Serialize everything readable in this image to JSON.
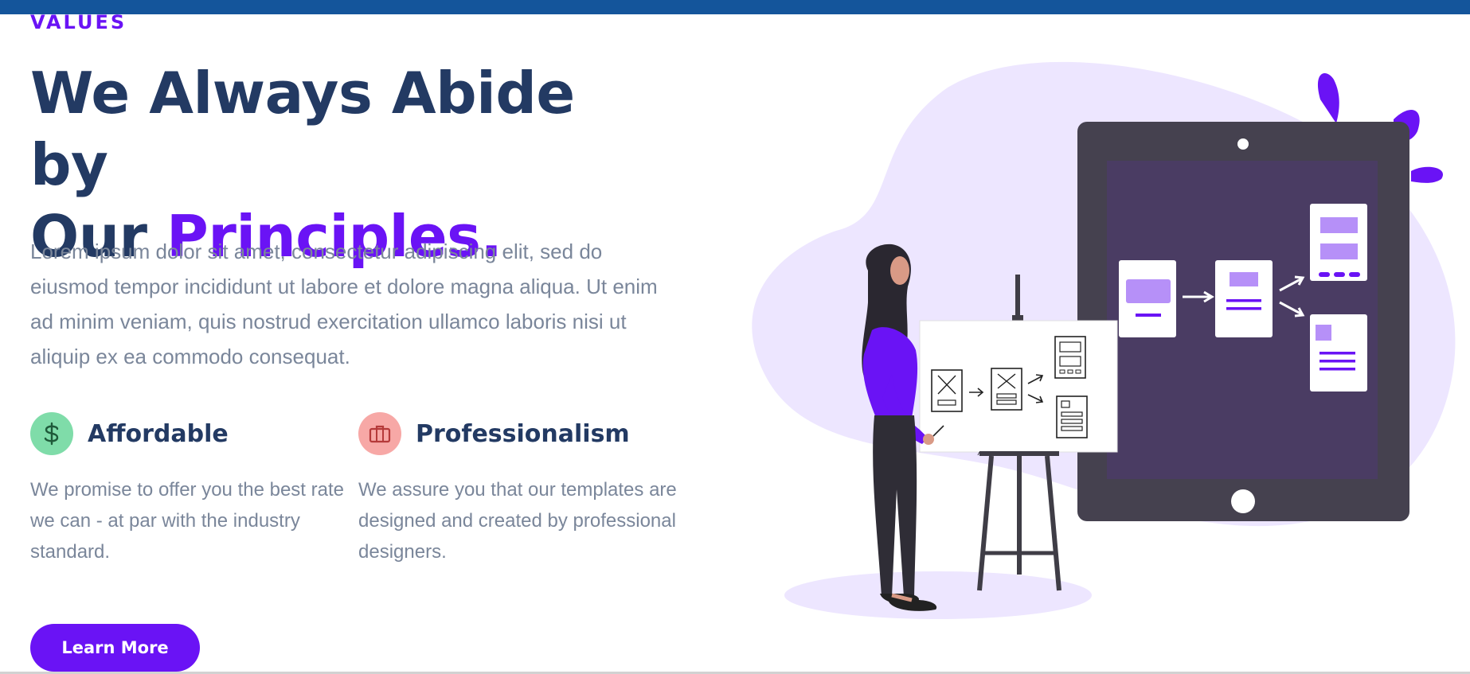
{
  "section": {
    "eyebrow": "VALUES",
    "headline_line1": "We Always Abide by",
    "headline_line2_prefix": "Our ",
    "headline_accent": "Principles.",
    "lead": "Lorem ipsum dolor sit amet, consectetur adipiscing elit, sed do eiusmod tempor incididunt ut labore et dolore magna aliqua. Ut enim ad minim veniam, quis nostrud exercitation ullamco laboris nisi ut aliquip ex ea commodo consequat."
  },
  "features": [
    {
      "icon": "dollar-icon",
      "title": "Affordable",
      "description": "We promise to offer you the best rate we can - at par with the industry standard."
    },
    {
      "icon": "briefcase-icon",
      "title": "Professionalism",
      "description": "We assure you that our templates are designed and created by professional designers."
    }
  ],
  "cta": {
    "label": "Learn More"
  },
  "colors": {
    "accent": "#6a13f5",
    "heading": "#233a63",
    "body_text": "#7a869a",
    "topbar": "#14559b"
  }
}
